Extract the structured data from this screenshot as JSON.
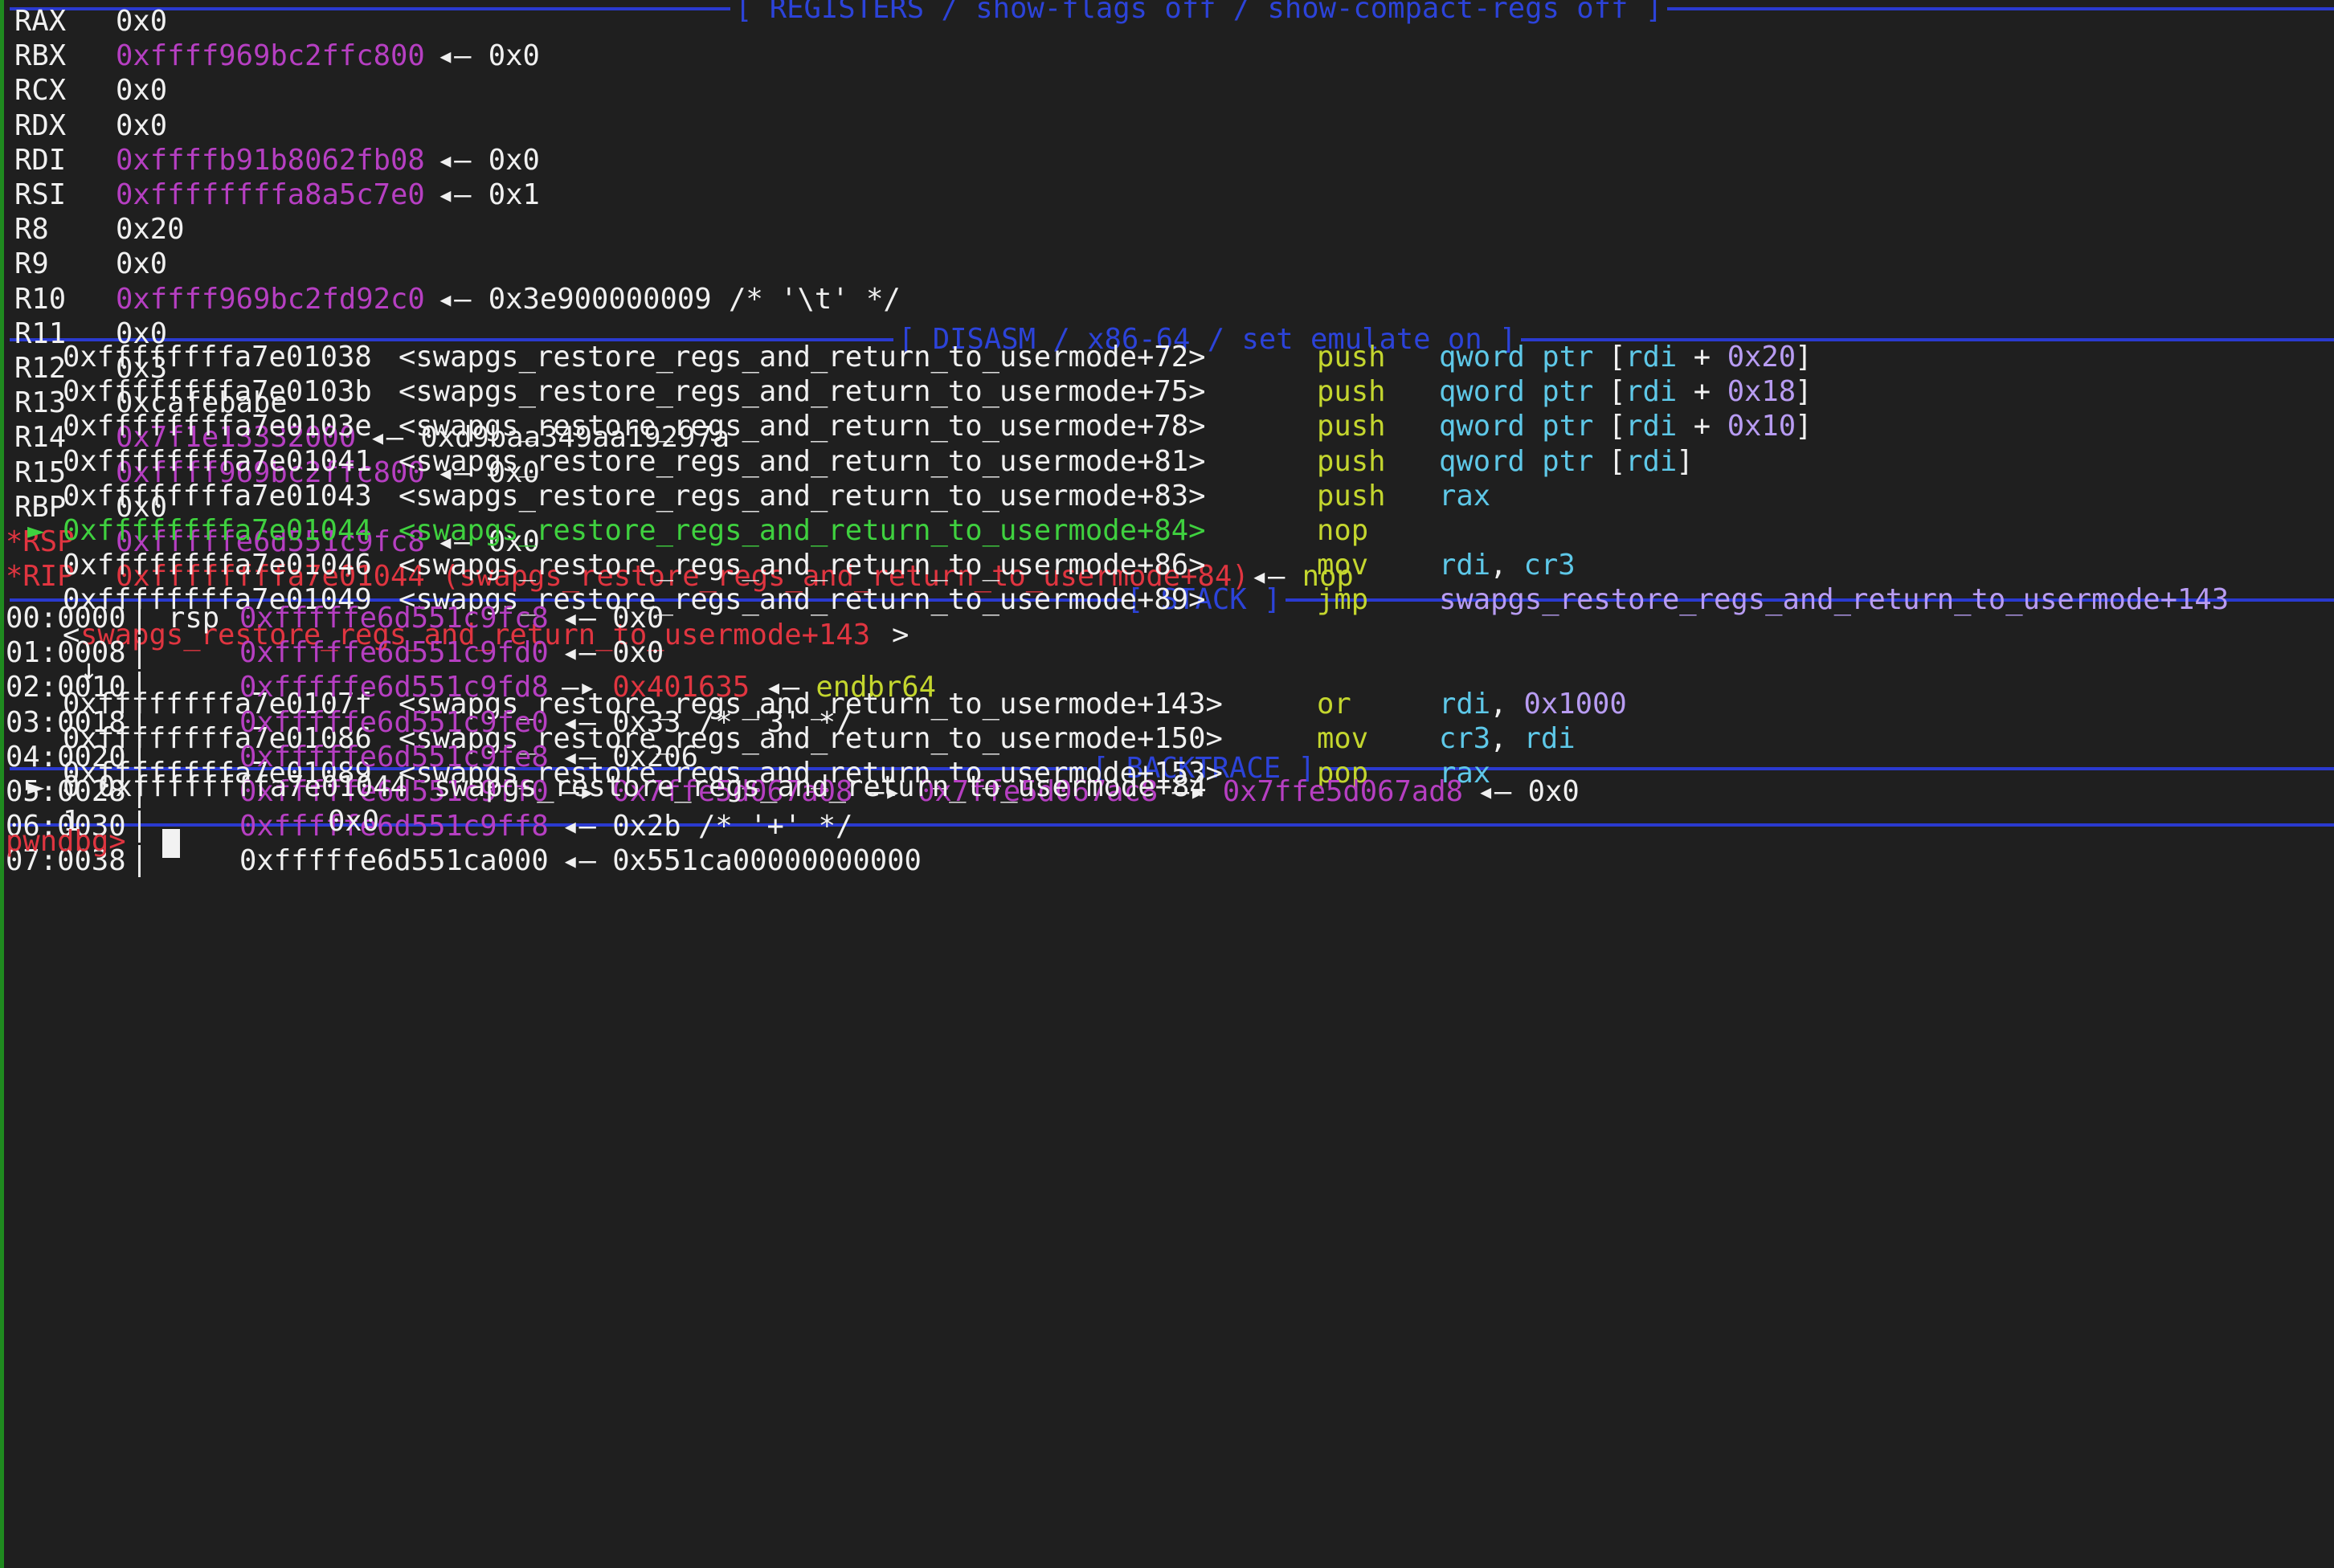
{
  "headers": {
    "registers": "[ REGISTERS / show-flags off / show-compact-regs off ]",
    "disasm": "[ DISASM / x86-64 / set emulate on ]",
    "stack": "[ STACK ]",
    "backtrace": "[ BACKTRACE ]"
  },
  "registers": [
    {
      "name": "RAX",
      "value": "0x0"
    },
    {
      "name": "RBX",
      "value": "0xffff969bc2ffc800",
      "deref": "0x0"
    },
    {
      "name": "RCX",
      "value": "0x0"
    },
    {
      "name": "RDX",
      "value": "0x0"
    },
    {
      "name": "RDI",
      "value": "0xffffb91b8062fb08",
      "deref": "0x0"
    },
    {
      "name": "RSI",
      "value": "0xffffffffa8a5c7e0",
      "deref": "0x1"
    },
    {
      "name": "R8",
      "value": "0x20"
    },
    {
      "name": "R9",
      "value": "0x0"
    },
    {
      "name": "R10",
      "value": "0xffff969bc2fd92c0",
      "deref": "0x3e900000009 /* '\\t' */"
    },
    {
      "name": "R11",
      "value": "0x0"
    },
    {
      "name": "R12",
      "value": "0x3"
    },
    {
      "name": "R13",
      "value": "0xcafebabe"
    },
    {
      "name": "R14",
      "value": "0x7f1e13332000",
      "deref": "0xd9baa349aa19297a"
    },
    {
      "name": "R15",
      "value": "0xffff969bc2ffc800",
      "deref": "0x0"
    },
    {
      "name": "RBP",
      "value": "0x0"
    },
    {
      "name": "*RSP",
      "value": "0xfffffe6d551c9fc8",
      "deref": "0x0"
    },
    {
      "name": "*RIP",
      "value": "0xffffffffa7e01044 (swapgs_restore_regs_and_return_to_usermode+84)",
      "deref": "nop"
    }
  ],
  "arrow": "◂—",
  "disasm": [
    {
      "addr": "0xffffffffa7e01038",
      "sym": "<swapgs_restore_regs_and_return_to_usermode+72>",
      "mn": "push",
      "ops": [
        [
          "qword ptr ",
          "c"
        ],
        [
          "[",
          "w"
        ],
        [
          "rdi",
          "c"
        ],
        [
          " + ",
          "w"
        ],
        [
          "0x20",
          "v"
        ],
        [
          "]",
          "w"
        ]
      ]
    },
    {
      "addr": "0xffffffffa7e0103b",
      "sym": "<swapgs_restore_regs_and_return_to_usermode+75>",
      "mn": "push",
      "ops": [
        [
          "qword ptr ",
          "c"
        ],
        [
          "[",
          "w"
        ],
        [
          "rdi",
          "c"
        ],
        [
          " + ",
          "w"
        ],
        [
          "0x18",
          "v"
        ],
        [
          "]",
          "w"
        ]
      ]
    },
    {
      "addr": "0xffffffffa7e0103e",
      "sym": "<swapgs_restore_regs_and_return_to_usermode+78>",
      "mn": "push",
      "ops": [
        [
          "qword ptr ",
          "c"
        ],
        [
          "[",
          "w"
        ],
        [
          "rdi",
          "c"
        ],
        [
          " + ",
          "w"
        ],
        [
          "0x10",
          "v"
        ],
        [
          "]",
          "w"
        ]
      ]
    },
    {
      "addr": "0xffffffffa7e01041",
      "sym": "<swapgs_restore_regs_and_return_to_usermode+81>",
      "mn": "push",
      "ops": [
        [
          "qword ptr ",
          "c"
        ],
        [
          "[",
          "w"
        ],
        [
          "rdi",
          "c"
        ],
        [
          "]",
          "w"
        ]
      ]
    },
    {
      "addr": "0xffffffffa7e01043",
      "sym": "<swapgs_restore_regs_and_return_to_usermode+83>",
      "mn": "push",
      "ops": [
        [
          "rax",
          "c"
        ]
      ]
    },
    {
      "addr": "0xffffffffa7e01044",
      "sym": "<swapgs_restore_regs_and_return_to_usermode+84>",
      "mn": "nop",
      "ops": [],
      "current": true
    },
    {
      "addr": "0xffffffffa7e01046",
      "sym": "<swapgs_restore_regs_and_return_to_usermode+86>",
      "mn": "mov",
      "ops": [
        [
          "rdi",
          "c"
        ],
        [
          ", ",
          "w"
        ],
        [
          "cr3",
          "c"
        ]
      ]
    },
    {
      "addr": "0xffffffffa7e01049",
      "sym": "<swapgs_restore_regs_and_return_to_usermode+89>",
      "mn": "jmp",
      "ops": [
        [
          "swapgs_restore_regs_and_return_to_usermode+143",
          "v"
        ]
      ]
    }
  ],
  "jump_target": {
    "open": "<",
    "name": "swapgs_restore_regs_and_return_to_usermode+143",
    "close": ">"
  },
  "down_arrow": "↓",
  "current_marker": "►",
  "disasm2": [
    {
      "addr": "0xffffffffa7e0107f",
      "sym": "<swapgs_restore_regs_and_return_to_usermode+143>",
      "mn": "or",
      "ops": [
        [
          "rdi",
          "c"
        ],
        [
          ", ",
          "w"
        ],
        [
          "0x1000",
          "v"
        ]
      ]
    },
    {
      "addr": "0xffffffffa7e01086",
      "sym": "<swapgs_restore_regs_and_return_to_usermode+150>",
      "mn": "mov",
      "ops": [
        [
          "cr3",
          "c"
        ],
        [
          ", ",
          "w"
        ],
        [
          "rdi",
          "c"
        ]
      ]
    },
    {
      "addr": "0xffffffffa7e01089",
      "sym": "<swapgs_restore_regs_and_return_to_usermode+153>",
      "mn": "pop",
      "ops": [
        [
          "rax",
          "c"
        ]
      ]
    }
  ],
  "stack": [
    {
      "off": "00:0000",
      "reg": "rsp",
      "chain": [
        [
          "0xfffffe6d551c9fc8",
          "p"
        ],
        [
          " ◂— ",
          "w"
        ],
        [
          "0x0",
          "w"
        ]
      ]
    },
    {
      "off": "01:0008",
      "reg": "",
      "chain": [
        [
          "0xfffffe6d551c9fd0",
          "p"
        ],
        [
          " ◂— ",
          "w"
        ],
        [
          "0x0",
          "w"
        ]
      ]
    },
    {
      "off": "02:0010",
      "reg": "",
      "chain": [
        [
          "0xfffffe6d551c9fd8",
          "p"
        ],
        [
          " —▸ ",
          "w"
        ],
        [
          "0x401635",
          "r"
        ],
        [
          " ◂— ",
          "w"
        ],
        [
          "endbr64",
          "y"
        ]
      ]
    },
    {
      "off": "03:0018",
      "reg": "",
      "chain": [
        [
          "0xfffffe6d551c9fe0",
          "p"
        ],
        [
          " ◂— ",
          "w"
        ],
        [
          "0x33 /* '3' */",
          "w"
        ]
      ]
    },
    {
      "off": "04:0020",
      "reg": "",
      "chain": [
        [
          "0xfffffe6d551c9fe8",
          "p"
        ],
        [
          " ◂— ",
          "w"
        ],
        [
          "0x206",
          "w"
        ]
      ]
    },
    {
      "off": "05:0028",
      "reg": "",
      "chain": [
        [
          "0xfffffe6d551c9ff0",
          "p"
        ],
        [
          " —▸ ",
          "w"
        ],
        [
          "0x7ffe5d067a08",
          "p"
        ],
        [
          " —▸ ",
          "w"
        ],
        [
          "0x7ffe5d067ac8",
          "p"
        ],
        [
          " —▸ ",
          "w"
        ],
        [
          "0x7ffe5d067ad8",
          "p"
        ],
        [
          " ◂— ",
          "w"
        ],
        [
          "0x0",
          "w"
        ]
      ]
    },
    {
      "off": "06:0030",
      "reg": "",
      "chain": [
        [
          "0xfffffe6d551c9ff8",
          "p"
        ],
        [
          " ◂— ",
          "w"
        ],
        [
          "0x2b /* '+' */",
          "w"
        ]
      ]
    },
    {
      "off": "07:0038",
      "reg": "",
      "chain": [
        [
          "0xfffffe6d551ca000",
          "w"
        ],
        [
          " ◂— ",
          "w"
        ],
        [
          "0x551ca00000000000",
          "w"
        ]
      ]
    }
  ],
  "backtrace": [
    {
      "marker": "►",
      "idx": "0",
      "addr": "0xffffffffa7e01044",
      "sym": "swapgs_restore_regs_and_return_to_usermode+84"
    },
    {
      "marker": "",
      "idx": "1",
      "addr": "0x0",
      "sym": ""
    }
  ],
  "prompt": "pwndbg>"
}
